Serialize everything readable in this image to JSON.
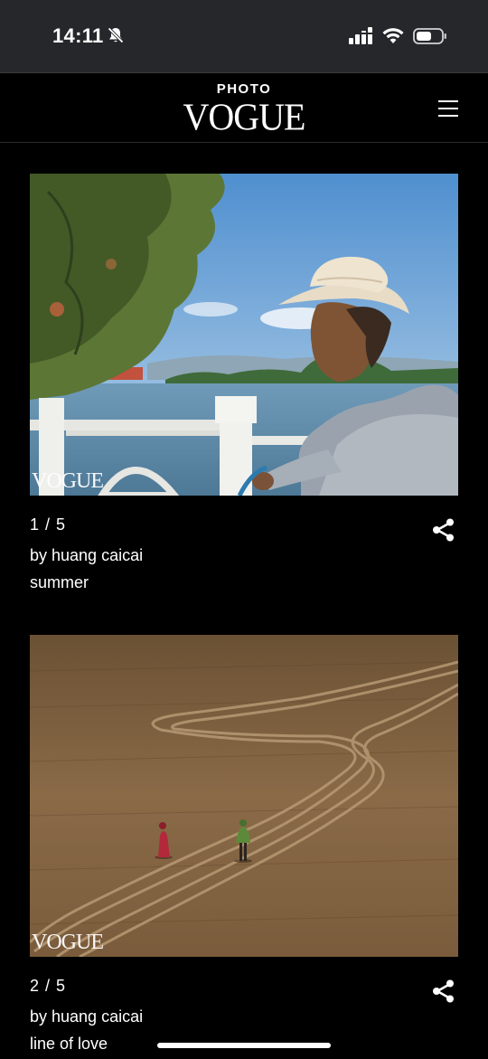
{
  "status_bar": {
    "time": "14:11",
    "icons": [
      "bell-slash-icon",
      "cellular-signal-icon",
      "wifi-icon",
      "battery-icon"
    ]
  },
  "header": {
    "brand_top": "PHOTO",
    "brand_main": "VOGUE",
    "menu_icon": "hamburger-menu-icon"
  },
  "photos": [
    {
      "counter": "1 / 5",
      "author": "by huang caicai",
      "caption": "summer",
      "watermark": "VOGUE",
      "share_icon": "share-icon"
    },
    {
      "counter": "2 / 5",
      "author": "by huang caicai",
      "caption": "line of love",
      "watermark": "VOGUE",
      "share_icon": "share-icon"
    }
  ],
  "colors": {
    "background": "#000000",
    "status_bar": "#26272a",
    "text": "#ffffff"
  }
}
